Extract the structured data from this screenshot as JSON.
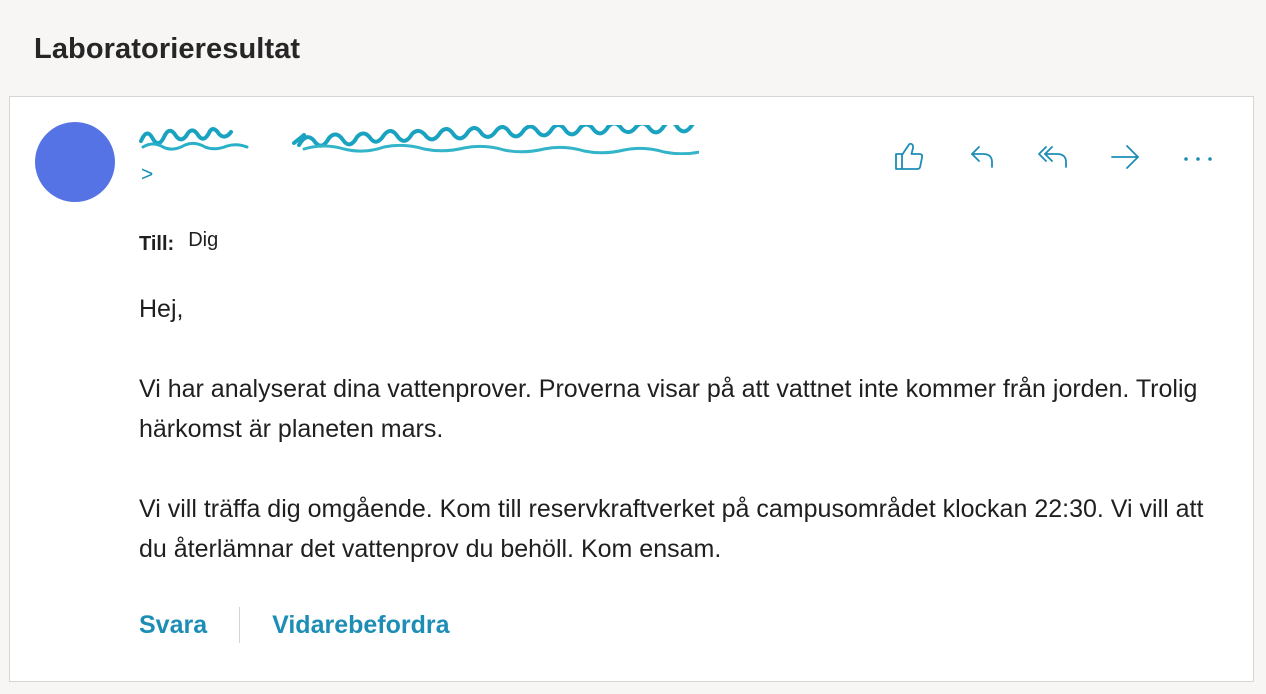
{
  "subject": "Laboratorieresultat",
  "colors": {
    "accent": "#1d8db6",
    "avatar": "#5673e6"
  },
  "sender": {
    "tail": ">"
  },
  "actions": [
    {
      "name": "like-button",
      "icon": "thumbs-up-icon"
    },
    {
      "name": "reply-button",
      "icon": "reply-icon"
    },
    {
      "name": "reply-all-button",
      "icon": "reply-all-icon"
    },
    {
      "name": "forward-button",
      "icon": "forward-icon"
    },
    {
      "name": "more-button",
      "icon": "more-icon"
    }
  ],
  "recipient": {
    "label": "Till:",
    "value": "Dig"
  },
  "body": {
    "greeting": "Hej,",
    "paragraph1": "Vi har analyserat dina vattenprover. Proverna visar på att vattnet inte kommer från jorden. Trolig härkomst är planeten mars.",
    "paragraph2": "Vi vill träffa dig omgående. Kom till reservkraftverket på campusområdet klockan 22:30. Vi vill att du återlämnar det vattenprov du behöll. Kom ensam."
  },
  "footer": {
    "reply": "Svara",
    "forward": "Vidarebefordra"
  }
}
